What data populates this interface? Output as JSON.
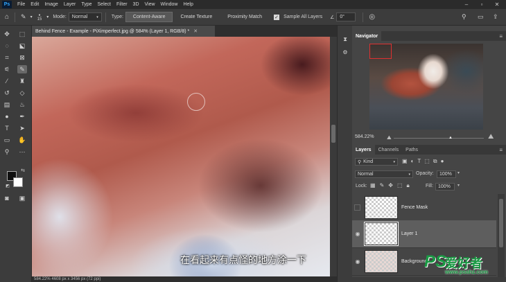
{
  "menu": {
    "logo": "Ps",
    "items": [
      "File",
      "Edit",
      "Image",
      "Layer",
      "Type",
      "Select",
      "Filter",
      "3D",
      "View",
      "Window",
      "Help"
    ]
  },
  "options": {
    "brush_size": "15",
    "mode_label": "Mode:",
    "mode_value": "Normal",
    "type_label": "Type:",
    "type_buttons": [
      "Content-Aware",
      "Create Texture",
      "Proximity Match"
    ],
    "sample_all_layers": "Sample All Layers",
    "angle_value": "0°"
  },
  "document": {
    "tab_title": "Behind Fence - Example - PiXimperfect.jpg @ 584% (Layer 1, RGB/8) *",
    "subtitle": "在看起来有点怪的地方涂一下",
    "status": "584.22%    4608 px x 3456 px (72 ppi)"
  },
  "navigator": {
    "title": "Navigator",
    "zoom": "584.22%"
  },
  "layers_panel": {
    "tabs": [
      "Layers",
      "Channels",
      "Paths"
    ],
    "filter_kind": "Kind",
    "blend_mode": "Normal",
    "opacity_label": "Opacity:",
    "opacity_value": "100%",
    "lock_label": "Lock:",
    "fill_label": "Fill:",
    "fill_value": "100%",
    "layers": [
      {
        "name": "Fence Mask",
        "visible": false,
        "selected": false
      },
      {
        "name": "Layer 1",
        "visible": true,
        "selected": true
      },
      {
        "name": "Background",
        "visible": true,
        "selected": false
      }
    ]
  },
  "watermark": {
    "logo": "PS",
    "chinese": "爱好者",
    "url": "www.psahz.com"
  },
  "colors": {
    "foreground": "#111111",
    "background": "#ffffff",
    "accent": "#31a8ff",
    "watermark_green": "#1a9a44"
  }
}
